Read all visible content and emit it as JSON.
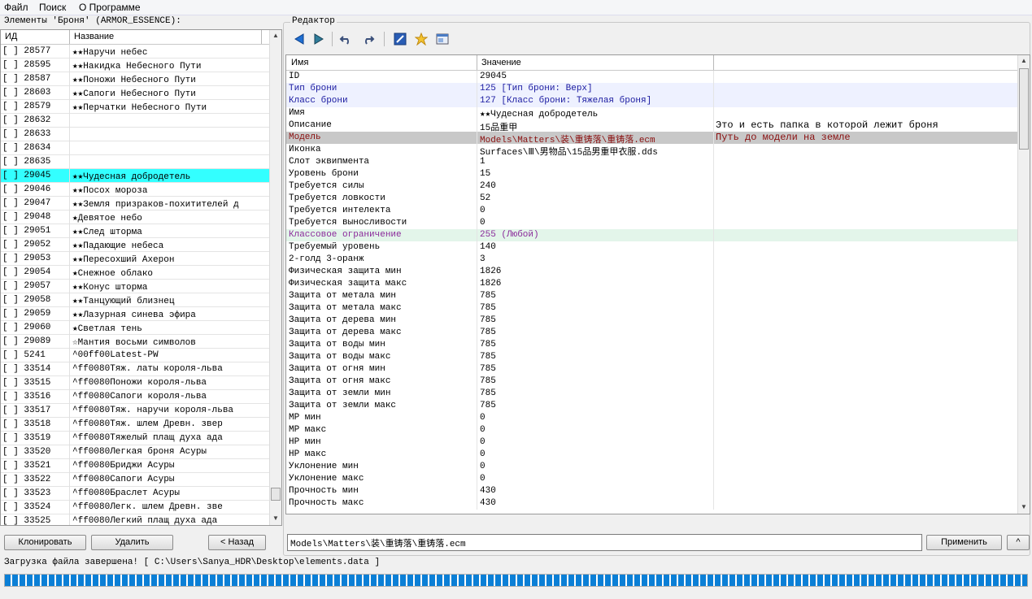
{
  "menu": [
    "Файл",
    "Поиск",
    "О Программе"
  ],
  "left": {
    "title": "Элементы 'Броня' (ARMOR_ESSENCE):",
    "col_id": "ИД",
    "col_name": "Название",
    "rows": [
      {
        "id": "[ ] 28577",
        "name": "★★Наручи небес"
      },
      {
        "id": "[ ] 28595",
        "name": "★★Накидка Небесного Пути"
      },
      {
        "id": "[ ] 28587",
        "name": "★★Поножи Небесного Пути"
      },
      {
        "id": "[ ] 28603",
        "name": "★★Сапоги Небесного Пути"
      },
      {
        "id": "[ ] 28579",
        "name": "★★Перчатки Небесного Пути"
      },
      {
        "id": "[ ] 28632",
        "name": ""
      },
      {
        "id": "[ ] 28633",
        "name": ""
      },
      {
        "id": "[ ] 28634",
        "name": ""
      },
      {
        "id": "[ ] 28635",
        "name": ""
      },
      {
        "id": "[ ] 29045",
        "name": "★★Чудесная добродетель",
        "selected": true
      },
      {
        "id": "[ ] 29046",
        "name": "★★Посох мороза"
      },
      {
        "id": "[ ] 29047",
        "name": "★★Земля призраков-похитителей д"
      },
      {
        "id": "[ ] 29048",
        "name": "★Девятое небо"
      },
      {
        "id": "[ ] 29051",
        "name": "★★След шторма"
      },
      {
        "id": "[ ] 29052",
        "name": "★★Падающие небеса"
      },
      {
        "id": "[ ] 29053",
        "name": "★★Пересохший Ахерон"
      },
      {
        "id": "[ ] 29054",
        "name": "★Снежное облако"
      },
      {
        "id": "[ ] 29057",
        "name": "★★Конус шторма"
      },
      {
        "id": "[ ] 29058",
        "name": "★★Танцующий близнец"
      },
      {
        "id": "[ ] 29059",
        "name": "★★Лазурная синева эфира"
      },
      {
        "id": "[ ] 29060",
        "name": "★Светлая тень"
      },
      {
        "id": "[ ] 29089",
        "name": "☆Мантия восьми символов"
      },
      {
        "id": "[ ] 5241",
        "name": "^00ff00Latest-PW"
      },
      {
        "id": "[ ] 33514",
        "name": "^ff0080Тяж. латы короля-льва"
      },
      {
        "id": "[ ] 33515",
        "name": "^ff0080Поножи короля-льва"
      },
      {
        "id": "[ ] 33516",
        "name": "^ff0080Сапоги короля-льва"
      },
      {
        "id": "[ ] 33517",
        "name": "^ff0080Тяж. наручи короля-льва"
      },
      {
        "id": "[ ] 33518",
        "name": "^ff0080Тяж. шлем Древн. звер"
      },
      {
        "id": "[ ] 33519",
        "name": "^ff0080Тяжелый плащ духа ада"
      },
      {
        "id": "[ ] 33520",
        "name": "^ff0080Легкая броня Асуры"
      },
      {
        "id": "[ ] 33521",
        "name": "^ff0080Бриджи Асуры"
      },
      {
        "id": "[ ] 33522",
        "name": "^ff0080Сапоги Асуры"
      },
      {
        "id": "[ ] 33523",
        "name": "^ff0080Браслет Асуры"
      },
      {
        "id": "[ ] 33524",
        "name": "^ff0080Легк. шлем Древн. зве"
      },
      {
        "id": "[ ] 33525",
        "name": "^ff0080Легкий плащ духа ада"
      }
    ]
  },
  "buttons": {
    "clone": "Клонировать",
    "delete": "Удалить",
    "back": "< Назад",
    "apply": "Применить",
    "up": "^"
  },
  "editor": {
    "title": "Редактор",
    "col_name": "Имя",
    "col_value": "Значение",
    "rows": [
      {
        "name": "ID",
        "value": "29045",
        "comment": ""
      },
      {
        "name": "Тип брони",
        "value": "125 [Тип брони: Верх]",
        "comment": "",
        "style": "blue"
      },
      {
        "name": "Класс брони",
        "value": "127 [Класс брони: Тяжелая броня]",
        "comment": "",
        "style": "blue"
      },
      {
        "name": "Имя",
        "value": "★★Чудесная добродетель",
        "comment": ""
      },
      {
        "name": "Описание",
        "value": "15品重甲",
        "comment": "Это и есть папка в которой лежит броня"
      },
      {
        "name": "Модель",
        "value": "Models\\Matters\\装\\重铸落\\重铸落.ecm",
        "comment": "Путь до модели на земле",
        "style": "gray"
      },
      {
        "name": "Иконка",
        "value": "Surfaces\\Ⅲ\\男物品\\15品男重甲衣服.dds",
        "comment": ""
      },
      {
        "name": "Слот эквипмента",
        "value": "1",
        "comment": ""
      },
      {
        "name": "Уровень брони",
        "value": "15",
        "comment": ""
      },
      {
        "name": "Требуется силы",
        "value": "240",
        "comment": ""
      },
      {
        "name": "Требуется ловкости",
        "value": "52",
        "comment": ""
      },
      {
        "name": "Требуется интелекта",
        "value": "0",
        "comment": ""
      },
      {
        "name": "Требуется выносливости",
        "value": "0",
        "comment": ""
      },
      {
        "name": "Классовое ограничение",
        "value": "255 (Любой)",
        "comment": "",
        "style": "green"
      },
      {
        "name": "Требуемый уровень",
        "value": "140",
        "comment": ""
      },
      {
        "name": "2-голд 3-оранж",
        "value": "3",
        "comment": ""
      },
      {
        "name": "Физическая защита мин",
        "value": "1826",
        "comment": ""
      },
      {
        "name": "Физическая защита макс",
        "value": "1826",
        "comment": ""
      },
      {
        "name": "Защита от метала мин",
        "value": "785",
        "comment": ""
      },
      {
        "name": "Защита от метала макс",
        "value": "785",
        "comment": ""
      },
      {
        "name": "Защита от дерева мин",
        "value": "785",
        "comment": ""
      },
      {
        "name": "Защита от дерева макс",
        "value": "785",
        "comment": ""
      },
      {
        "name": "Защита от воды мин",
        "value": "785",
        "comment": ""
      },
      {
        "name": "Защита от воды макс",
        "value": "785",
        "comment": ""
      },
      {
        "name": "Защита от огня мин",
        "value": "785",
        "comment": ""
      },
      {
        "name": "Защита от огня макс",
        "value": "785",
        "comment": ""
      },
      {
        "name": "Защита от земли мин",
        "value": "785",
        "comment": ""
      },
      {
        "name": "Защита от земли макс",
        "value": "785",
        "comment": ""
      },
      {
        "name": "MP мин",
        "value": "0",
        "comment": ""
      },
      {
        "name": "MP макс",
        "value": "0",
        "comment": ""
      },
      {
        "name": "HP мин",
        "value": "0",
        "comment": ""
      },
      {
        "name": "HP макс",
        "value": "0",
        "comment": ""
      },
      {
        "name": "Уклонение мин",
        "value": "0",
        "comment": ""
      },
      {
        "name": "Уклонение макс",
        "value": "0",
        "comment": ""
      },
      {
        "name": "Прочность мин",
        "value": "430",
        "comment": ""
      },
      {
        "name": "Прочность макс",
        "value": "430",
        "comment": ""
      }
    ],
    "input_value": "Models\\Matters\\装\\重铸落\\重铸落.ecm"
  },
  "toolbar_icons": [
    "back-arrow-icon",
    "forward-arrow-icon",
    "undo-icon",
    "redo-icon",
    "edit-icon",
    "star-new-icon",
    "window-icon"
  ],
  "status": {
    "text": "Загрузка файла завершена! [ C:\\Users\\Sanya_HDR\\Desktop\\elements.data ]",
    "progress": 1.0
  },
  "colors": {
    "selection": "#33ffff",
    "progress": "#0b7fd6",
    "blue_row": "#eef1ff",
    "green_row": "#e3f5ea",
    "gray_row": "#c8c8c8"
  }
}
